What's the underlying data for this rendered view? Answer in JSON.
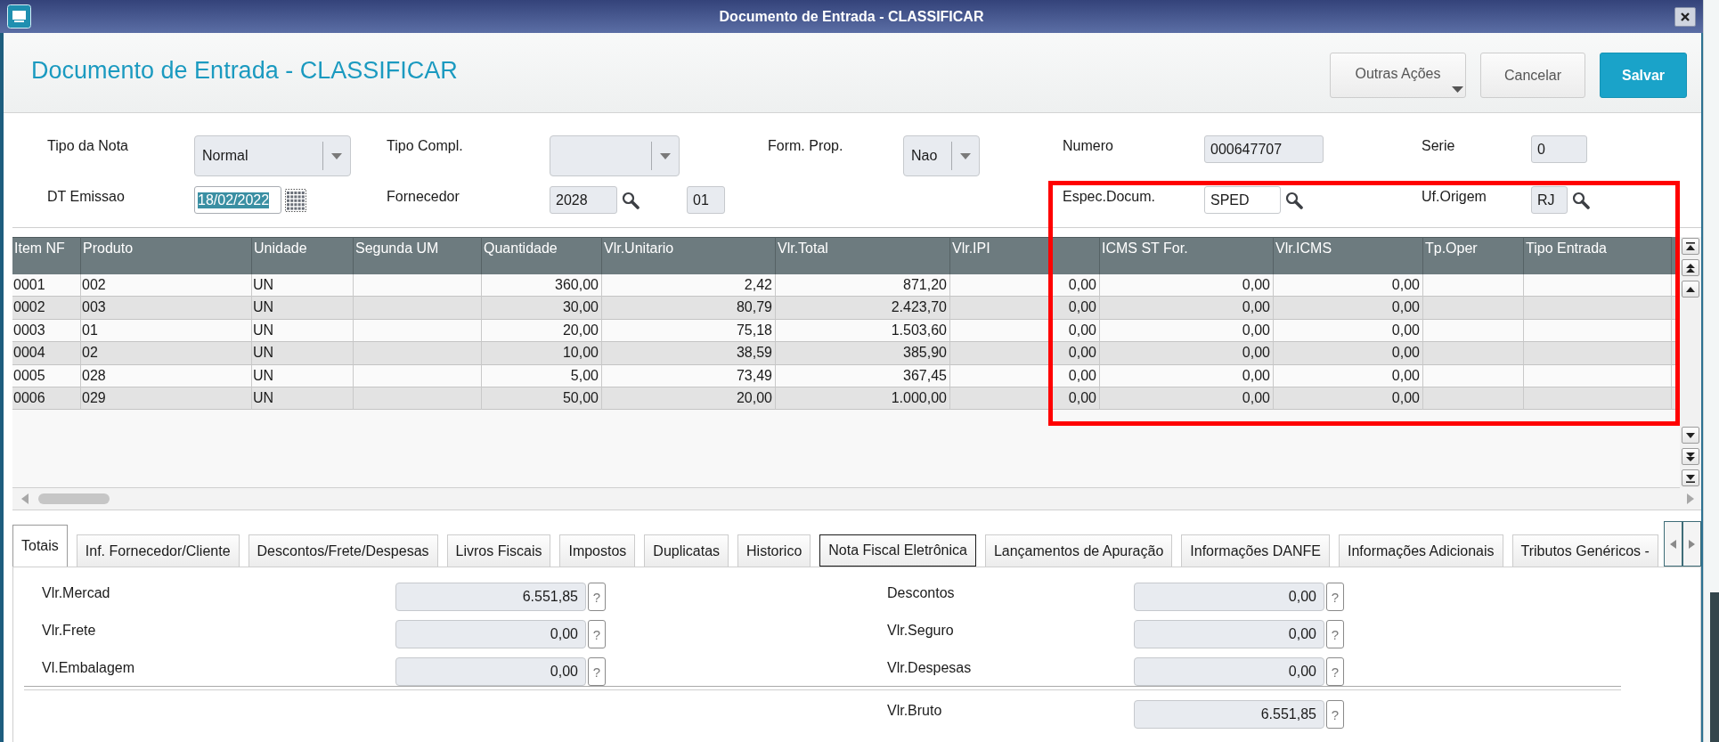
{
  "window": {
    "title": "Documento de Entrada - CLASSIFICAR"
  },
  "header": {
    "title": "Documento de Entrada - CLASSIFICAR",
    "buttons": [
      {
        "label": "Outras Ações",
        "kind": "menu"
      },
      {
        "label": "Cancelar",
        "kind": "secondary"
      },
      {
        "label": "Salvar",
        "kind": "primary"
      }
    ]
  },
  "form": {
    "columns": [
      {
        "fields": [
          {
            "label": "Tipo da Nota",
            "kind": "select",
            "value": "Normal",
            "readonly": true,
            "text_selected": false
          },
          {
            "label": "DT Emissao",
            "kind": "date",
            "value": "18/02/2022",
            "readonly": false,
            "text_selected": true
          }
        ]
      },
      {
        "fields": [
          {
            "label": "Tipo Compl.",
            "kind": "select",
            "readonly": true,
            "text_selected": false
          },
          {
            "label": "Fornecedor",
            "kind": "lookup",
            "value": "2028",
            "extra_value": "01",
            "readonly": true,
            "text_selected": false
          }
        ]
      },
      {
        "fields": [
          {
            "label": "Form. Prop.",
            "kind": "select",
            "value": "Nao",
            "readonly": true,
            "text_selected": false
          }
        ]
      },
      {
        "fields": [
          {
            "label": "Numero",
            "kind": "text",
            "value": "000647707",
            "readonly": true,
            "text_selected": false
          },
          {
            "label": "Espec.Docum.",
            "kind": "lookup",
            "value": "SPED",
            "readonly": false,
            "text_selected": false
          }
        ]
      },
      {
        "fields": [
          {
            "label": "Serie",
            "kind": "text",
            "value": "0",
            "readonly": true,
            "text_selected": false
          },
          {
            "label": "Uf.Origem",
            "kind": "lookup",
            "value": "RJ",
            "readonly": true,
            "text_selected": false
          }
        ]
      }
    ]
  },
  "table": {
    "columns": [
      {
        "label": "Item NF",
        "kind": "text"
      },
      {
        "label": "Produto",
        "kind": "text"
      },
      {
        "label": "Unidade",
        "kind": "text"
      },
      {
        "label": "Segunda UM",
        "kind": "text"
      },
      {
        "label": "Quantidade",
        "kind": "number"
      },
      {
        "label": "Vlr.Unitario",
        "kind": "number"
      },
      {
        "label": "Vlr.Total",
        "kind": "number"
      },
      {
        "label": "Vlr.IPI",
        "kind": "number"
      },
      {
        "label": "ICMS ST For.",
        "kind": "number"
      },
      {
        "label": "Vlr.ICMS",
        "kind": "number"
      },
      {
        "label": "Tp.Oper",
        "kind": "text"
      },
      {
        "label": "Tipo Entrada",
        "kind": "text"
      }
    ],
    "rows": [
      {
        "cells": [
          "0001",
          "002",
          "UN",
          null,
          "360,00",
          "2,42",
          "871,20",
          "0,00",
          "0,00",
          "0,00",
          null,
          null
        ]
      },
      {
        "cells": [
          "0002",
          "003",
          "UN",
          null,
          "30,00",
          "80,79",
          "2.423,70",
          "0,00",
          "0,00",
          "0,00",
          null,
          null
        ]
      },
      {
        "cells": [
          "0003",
          "01",
          "UN",
          null,
          "20,00",
          "75,18",
          "1.503,60",
          "0,00",
          "0,00",
          "0,00",
          null,
          null
        ]
      },
      {
        "cells": [
          "0004",
          "02",
          "UN",
          null,
          "10,00",
          "38,59",
          "385,90",
          "0,00",
          "0,00",
          "0,00",
          null,
          null
        ]
      },
      {
        "cells": [
          "0005",
          "028",
          "UN",
          null,
          "5,00",
          "73,49",
          "367,45",
          "0,00",
          "0,00",
          "0,00",
          null,
          null
        ]
      },
      {
        "cells": [
          "0006",
          "029",
          "UN",
          null,
          "50,00",
          "20,00",
          "1.000,00",
          "0,00",
          "0,00",
          "0,00",
          null,
          null
        ]
      }
    ]
  },
  "tabs": [
    {
      "label": "Totais",
      "selected": true,
      "focused": false
    },
    {
      "label": "Inf. Fornecedor/Cliente",
      "selected": false,
      "focused": false
    },
    {
      "label": "Descontos/Frete/Despesas",
      "selected": false,
      "focused": false
    },
    {
      "label": "Livros Fiscais",
      "selected": false,
      "focused": false
    },
    {
      "label": "Impostos",
      "selected": false,
      "focused": false
    },
    {
      "label": "Duplicatas",
      "selected": false,
      "focused": false
    },
    {
      "label": "Historico",
      "selected": false,
      "focused": false
    },
    {
      "label": "Nota Fiscal Eletrônica",
      "selected": false,
      "focused": true
    },
    {
      "label": "Lançamentos de Apuração",
      "selected": false,
      "focused": false
    },
    {
      "label": "Informações DANFE",
      "selected": false,
      "focused": false
    },
    {
      "label": "Informações Adicionais",
      "selected": false,
      "focused": false
    },
    {
      "label": "Tributos Genéricos -",
      "selected": false,
      "focused": false
    }
  ],
  "totals": {
    "fields": [
      {
        "label": "Vlr.Mercad",
        "value": "6.551,85",
        "help": "?"
      },
      {
        "label": "Descontos",
        "value": "0,00",
        "help": "?"
      },
      {
        "label": "Vlr.Frete",
        "value": "0,00",
        "help": "?"
      },
      {
        "label": "Vlr.Seguro",
        "value": "0,00",
        "help": "?"
      },
      {
        "label": "Vl.Embalagem",
        "value": "0,00",
        "help": "?"
      },
      {
        "label": "Vlr.Despesas",
        "value": "0,00",
        "help": "?"
      }
    ],
    "total": {
      "label": "Vlr.Bruto",
      "value": "6.551,85",
      "help": "?"
    }
  },
  "annotations": [
    {
      "kind": "rectangle"
    }
  ]
}
